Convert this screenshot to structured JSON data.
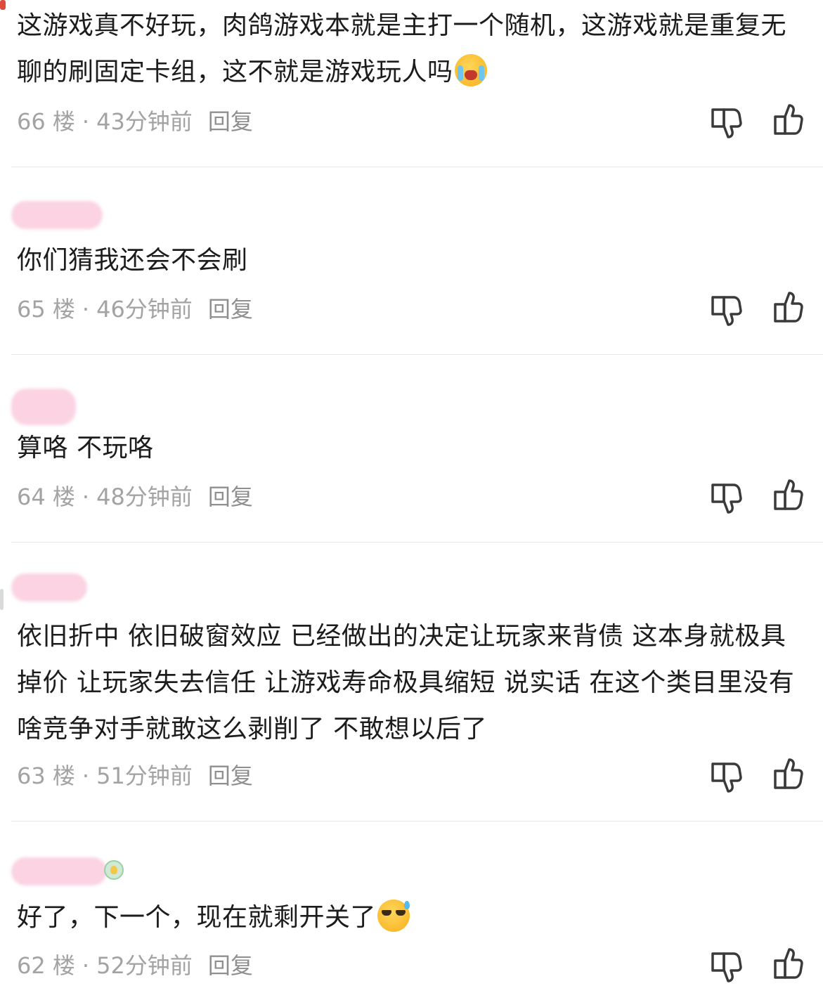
{
  "comments": [
    {
      "username": "",
      "text": "这游戏真不好玩，肉鸽游戏本就是主打一个随机，这游戏就是重复无聊的刷固定卡组，这不就是游戏玩人吗",
      "emoji": "crying-face-emoji",
      "floor": "66 楼",
      "time": "43分钟前",
      "reply": "回复"
    },
    {
      "username": "",
      "text": "你们猜我还会不会刷",
      "floor": "65 楼",
      "time": "46分钟前",
      "reply": "回复"
    },
    {
      "username": "",
      "text": "算咯 不玩咯",
      "floor": "64 楼",
      "time": "48分钟前",
      "reply": "回复"
    },
    {
      "username": "",
      "text": "依旧折中 依旧破窗效应 已经做出的决定让玩家来背债 这本身就极具掉价 让玩家失去信任 让游戏寿命极具缩短 说实话 在这个类目里没有啥竞争对手就敢这么剥削了 不敢想以后了",
      "floor": "63 楼",
      "time": "51分钟前",
      "reply": "回复"
    },
    {
      "username": "",
      "text": "好了，下一个，现在就剩开关了",
      "emoji": "cool-sweat-emoji",
      "floor": "62 楼",
      "time": "52分钟前",
      "reply": "回复"
    }
  ],
  "separator": "·",
  "colors": {
    "text": "#1c1c1c",
    "meta": "#a3a3a3",
    "icon": "#3a3a3a",
    "divider": "#e8e8e8",
    "blurred_name": "#fbd3e2"
  },
  "icons": {
    "dislike": "thumbs-down-icon",
    "like": "thumbs-up-icon"
  }
}
